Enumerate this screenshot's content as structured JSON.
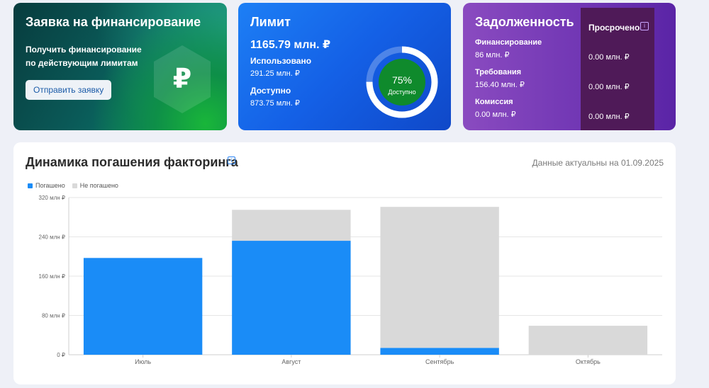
{
  "apply_card": {
    "title": "Заявка на финансирование",
    "description": "Получить финансирование по действующим лимитам",
    "button_label": "Отправить заявку",
    "icon": "ruble-hexagon-icon",
    "icon_symbol": "₽"
  },
  "limit_card": {
    "title": "Лимит",
    "total": "1165.79 млн. ₽",
    "used_label": "Использовано",
    "used_value": "291.25 млн. ₽",
    "available_label": "Доступно",
    "available_value": "873.75 млн. ₽",
    "available_percent_label": "75%",
    "available_percent": 75,
    "donut_caption": "Доступно"
  },
  "debt_card": {
    "title": "Задолженность",
    "rows": [
      {
        "label": "Финансирование",
        "value": "86 млн. ₽",
        "overdue": "0.00 млн. ₽"
      },
      {
        "label": "Требования",
        "value": "156.40 млн. ₽",
        "overdue": "0.00 млн. ₽"
      },
      {
        "label": "Комиссия",
        "value": "0.00 млн. ₽",
        "overdue": "0.00 млн. ₽"
      }
    ],
    "overdue_title": "Просрочено",
    "overdue_info_icon": "info-icon"
  },
  "chart_panel": {
    "title": "Динамика погашения факторинга",
    "info_icon": "info-icon",
    "data_date": "Данные актуальны на 01.09.2025"
  },
  "chart_data": {
    "type": "bar",
    "stacked": true,
    "categories": [
      "Июль",
      "Август",
      "Сентябрь",
      "Октябрь"
    ],
    "series": [
      {
        "name": "Погашено",
        "color": "#1a8cf7",
        "values": [
          197,
          232,
          14,
          0
        ]
      },
      {
        "name": "Не погашено",
        "color": "#d9d9d9",
        "values": [
          0,
          63,
          287,
          59
        ]
      }
    ],
    "yticks": [
      "0 ₽",
      "80 млн ₽",
      "160 млн ₽",
      "240 млн ₽",
      "320 млн ₽"
    ],
    "ylim": [
      0,
      320
    ],
    "grid": true,
    "legend": "top-left"
  },
  "colors": {
    "paid": "#1a8cf7",
    "unpaid": "#d9d9d9",
    "donut_ring": "#1a8cf7",
    "donut_center": "#0f8a2c"
  }
}
